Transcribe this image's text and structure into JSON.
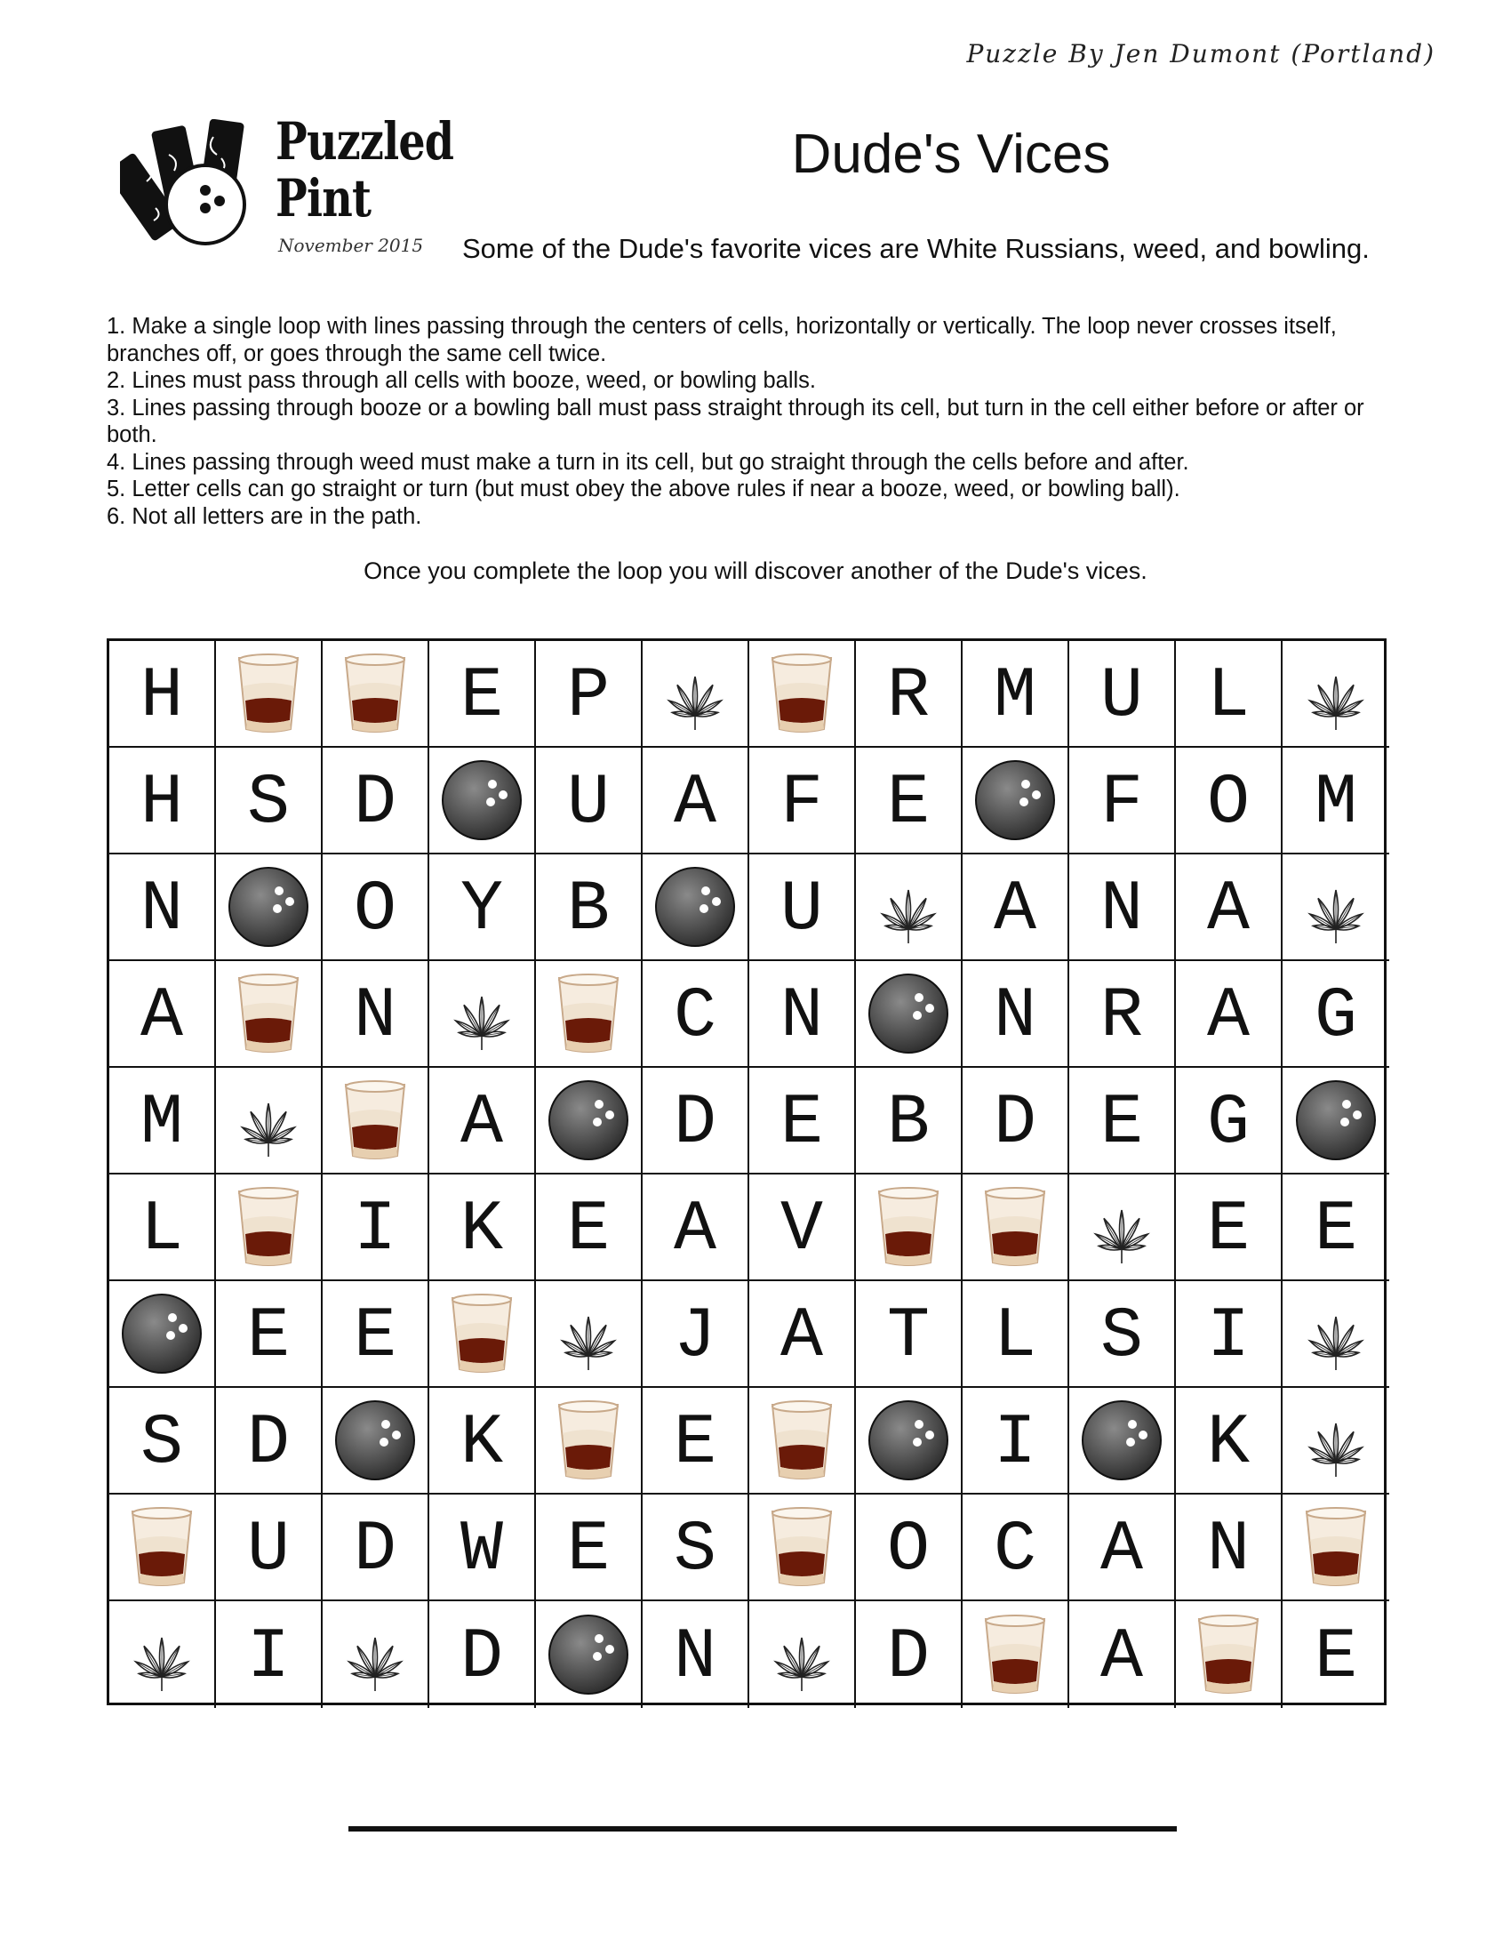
{
  "author": "Puzzle By Jen Dumont (Portland)",
  "logo": {
    "line1": "Puzzled",
    "line2": "Pint",
    "date": "November 2015"
  },
  "title": "Dude's Vices",
  "subtitle": "Some of the Dude's favorite vices are White Russians, weed, and bowling.",
  "rules": [
    "1.  Make a single loop with lines passing through the centers of cells, horizontally or vertically. The loop never crosses itself, branches off, or goes through the same cell twice.",
    "2.  Lines must pass through all cells with booze, weed, or bowling balls.",
    "3.  Lines passing through booze or a bowling ball must pass straight through its cell, but turn in the cell either before or after or both.",
    "4.  Lines passing through weed must make a turn in its cell, but go straight through the cells before and after.",
    "5.  Letter cells can go straight or turn (but must obey the above rules if near a booze, weed, or bowling ball).",
    "6.  Not all letters are in the path."
  ],
  "prompt": "Once you complete the loop you will discover another of the Dude's vices.",
  "legend": {
    "*": "booze-glass-icon",
    "#": "weed-leaf-icon",
    "@": "bowling-ball-icon"
  },
  "grid": [
    [
      "H",
      "*",
      "*",
      "E",
      "P",
      "#",
      "*",
      "R",
      "M",
      "U",
      "L",
      "#"
    ],
    [
      "H",
      "S",
      "D",
      "@",
      "U",
      "A",
      "F",
      "E",
      "@",
      "F",
      "O",
      "M"
    ],
    [
      "N",
      "@",
      "O",
      "Y",
      "B",
      "@",
      "U",
      "#",
      "A",
      "N",
      "A",
      "#"
    ],
    [
      "A",
      "*",
      "N",
      "#",
      "*",
      "C",
      "N",
      "@",
      "N",
      "R",
      "A",
      "G"
    ],
    [
      "M",
      "#",
      "*",
      "A",
      "@",
      "D",
      "E",
      "B",
      "D",
      "E",
      "G",
      "@"
    ],
    [
      "L",
      "*",
      "I",
      "K",
      "E",
      "A",
      "V",
      "*",
      "*",
      "#",
      "E",
      "E"
    ],
    [
      "@",
      "E",
      "E",
      "*",
      "#",
      "J",
      "A",
      "T",
      "L",
      "S",
      "I",
      "#"
    ],
    [
      "S",
      "D",
      "@",
      "K",
      "*",
      "E",
      "*",
      "@",
      "I",
      "@",
      "K",
      "#"
    ],
    [
      "*",
      "U",
      "D",
      "W",
      "E",
      "S",
      "*",
      "O",
      "C",
      "A",
      "N",
      "*"
    ],
    [
      "#",
      "I",
      "#",
      "D",
      "@",
      "N",
      "#",
      "D",
      "*",
      "A",
      "*",
      "E"
    ]
  ],
  "answer": ""
}
